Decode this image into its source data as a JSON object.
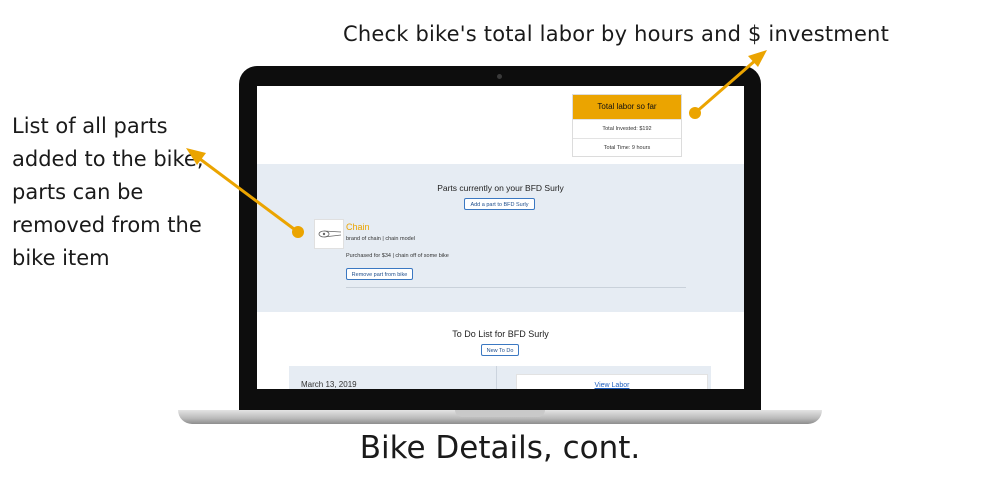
{
  "annotations": {
    "top": "Check bike's total labor by hours and $ investment",
    "left": "List of all parts added to the bike; parts can be removed from the bike item",
    "caption": "Bike Details, cont."
  },
  "screen": {
    "labor": {
      "header": "Total labor so far",
      "invested": "Total Invested: $192",
      "time": "Total Time: 9 hours"
    },
    "parts": {
      "title": "Parts currently on your BFD Surly",
      "add_button": "Add a part to BFD Surly",
      "items": [
        {
          "name": "Chain",
          "brand": "brand of chain | chain model",
          "purchase": "Purchased for $34 | chain off of some bike",
          "remove_button": "Remove part from bike",
          "thumbnail": "chain-icon"
        }
      ]
    },
    "todo": {
      "title": "To Do List for BFD Surly",
      "new_button": "New To Do",
      "date": "March 13, 2019",
      "view_labor": "View Labor"
    }
  },
  "colors": {
    "accent": "#eba400",
    "section_bg": "#e6ecf3",
    "link": "#1f5fbf"
  }
}
